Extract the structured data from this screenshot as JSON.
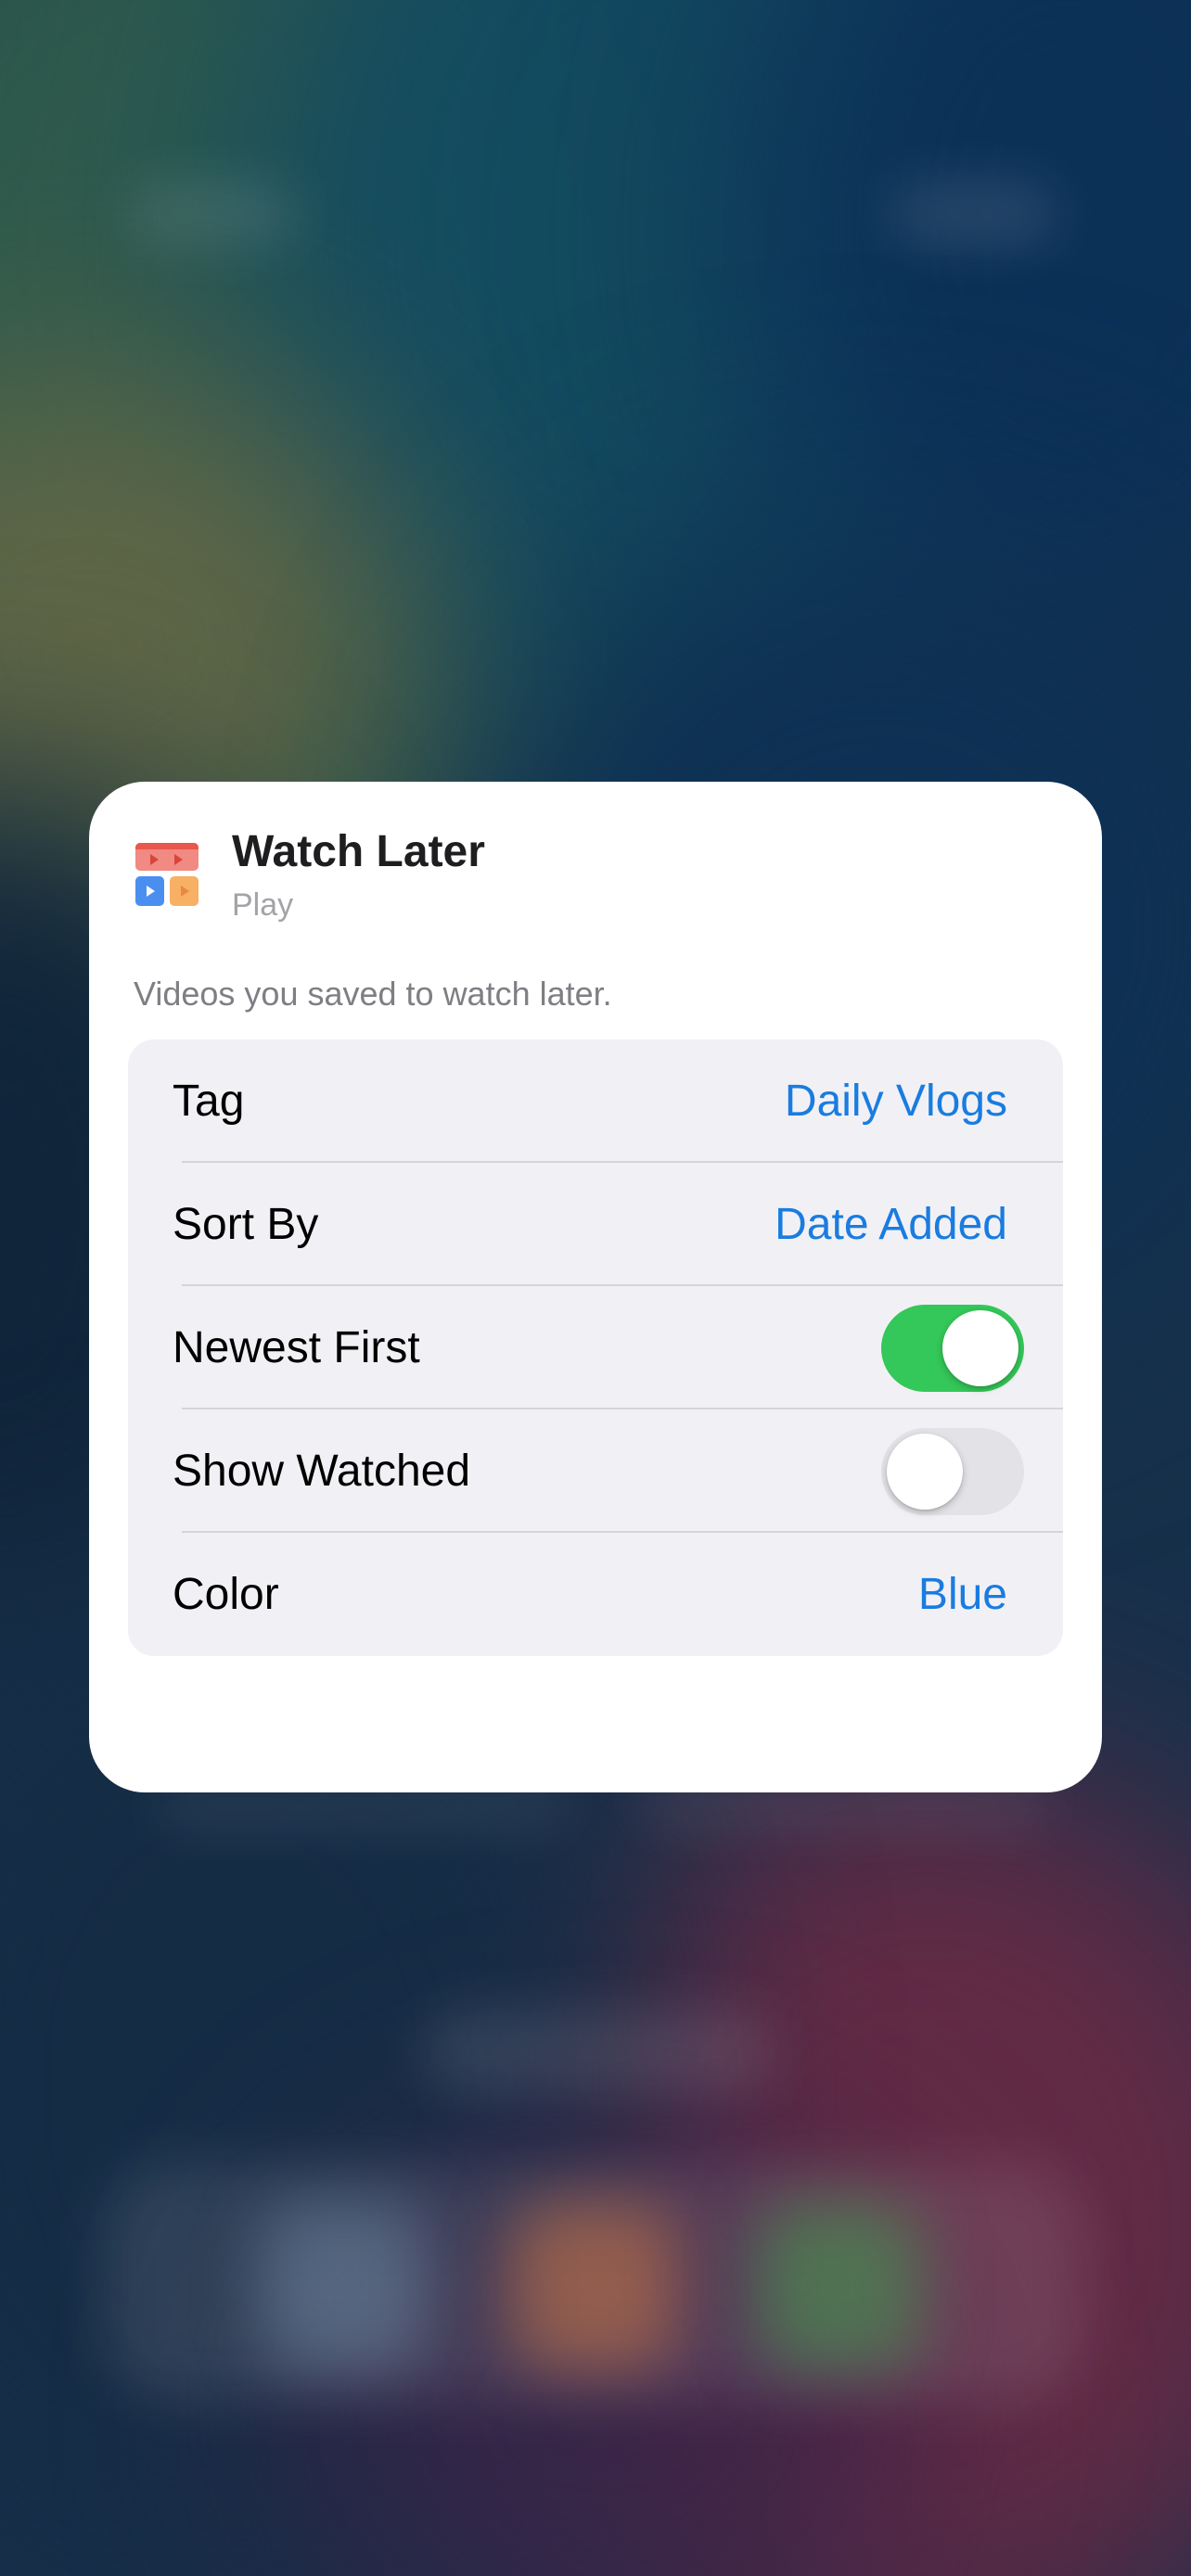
{
  "colors": {
    "accent": "#1a7ce0",
    "toggle_on": "#34c759",
    "toggle_off": "#e3e3e7",
    "card_background": "#ffffff",
    "settings_background": "#f1f1f5"
  },
  "widget": {
    "app_icon": "watch-later-app-icon",
    "title": "Watch Later",
    "subtitle": "Play",
    "description": "Videos you saved to watch later."
  },
  "settings": {
    "tag": {
      "label": "Tag",
      "value": "Daily Vlogs"
    },
    "sort_by": {
      "label": "Sort By",
      "value": "Date Added"
    },
    "newest_first": {
      "label": "Newest First",
      "on": true
    },
    "show_watched": {
      "label": "Show Watched",
      "on": false
    },
    "color": {
      "label": "Color",
      "value": "Blue"
    }
  }
}
